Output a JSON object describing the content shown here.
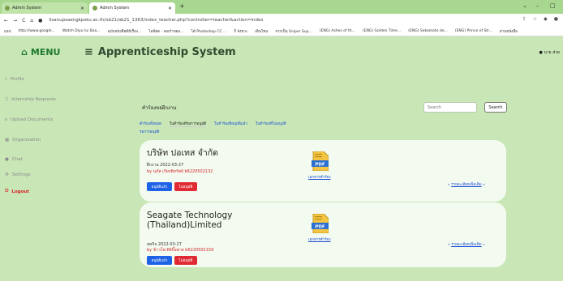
{
  "browser": {
    "tabs": [
      {
        "label": "Admin System",
        "active": false
      },
      {
        "label": "Admin System",
        "active": true
      }
    ],
    "url": "lisanupsaengkpsku.ac.th/ob21/ob21_1363/index_teacher.php?controller=teacher&action=index",
    "bookmarks": [
      "แอป",
      "http://www.google...",
      "Watch Diyu Iui Baa...",
      "ฉบับหนังสือดีมีเรื่อง...",
      "ไลฟ์สด - จอเก้าหอม...",
      "ได้ Photoshop CC ...",
      "ก็ จังหวะ",
      "เดินโทน",
      "จากเป็น Sniper Sup...",
      "(ENG) Ashes of th...",
      "(ENG) Golden Time...",
      "(ENG) Sekamoto de...",
      "(ENG) Prince of Str...",
      "อ่านหนังสือ"
    ],
    "window_controls": [
      "⌄",
      "–",
      "□"
    ]
  },
  "sidebar": {
    "menu_label": "MENU",
    "items": [
      {
        "label": "Profile",
        "icon": "chart-icon"
      },
      {
        "label": "Internship Requests",
        "icon": "funnel-icon"
      },
      {
        "label": "Upload Documents",
        "icon": "paperclip-icon"
      },
      {
        "label": "Organization",
        "icon": "building-icon"
      },
      {
        "label": "Chat",
        "icon": "chat-icon"
      },
      {
        "label": "Settings",
        "icon": "gear-icon"
      },
      {
        "label": "Logout",
        "icon": "power-icon"
      }
    ]
  },
  "header": {
    "title": "Apprenticeship System",
    "user": "นาย ส่วย"
  },
  "panel": {
    "title": "คำร้องขอฝึกงาน",
    "search_placeholder": "Search",
    "search_button": "Search",
    "tabs": [
      {
        "label": "คำร้องทั้งหมด",
        "active": false
      },
      {
        "label": "ใบคำร้องที่รอการอนุมัติ",
        "active": true
      },
      {
        "label": "ใบคำร้องที่อนุมัติแล้ว",
        "active": false
      },
      {
        "label": "ใบคำร้องที่ไม่อนุมัติ",
        "active": false
      }
    ],
    "subtab": "รอการอนุมัติ"
  },
  "requests": [
    {
      "company": "บริษัท ปอเทส จำกัด",
      "date": "ฝึกงาน 2022-03-27",
      "by": "by นภัส เกียรติทรัพย์ b6220502132",
      "doc_link": "เอกสารคำร้อง",
      "detail_link": "รายละเอียดเพิ่มเติม",
      "approve": "อนุมัติแล้ว",
      "reject": "ไม่อนุมัติ",
      "pdf_label": "PDF"
    },
    {
      "company": "Seagate Technology (Thailand)Limited",
      "date": "สหกิจ 2022-03-27",
      "by": "by ข้าวโพ ดิลิกิ๊อพาย b6220502159",
      "doc_link": "เอกสารคำร้อง",
      "detail_link": "รายละเอียดเพิ่มเติม",
      "approve": "อนุมัติแล้ว",
      "reject": "ไม่อนุมัติ",
      "pdf_label": "PDF"
    }
  ]
}
